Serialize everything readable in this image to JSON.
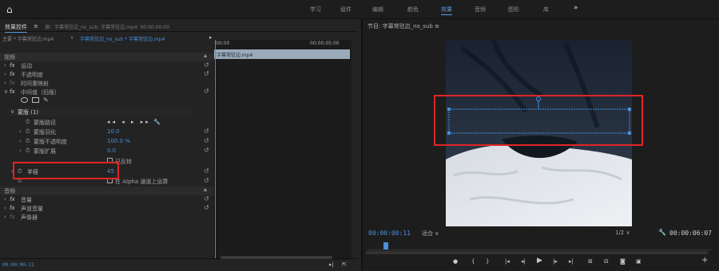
{
  "topbar": {
    "workspaces": [
      "学习",
      "组件",
      "编辑",
      "颜色",
      "效果",
      "音频",
      "图形",
      "库"
    ],
    "active": "效果",
    "more": "»"
  },
  "effect_controls": {
    "tab_label": "效果控件",
    "tab_menu": "≡",
    "other_tab": "源：字幕常驻边_no_sub: 字幕常驻边.mp4: 00:00:00:00",
    "source": "主要 * 字幕常驻边.mp4",
    "clip": "字幕常驻边_no_sub * 字幕常驻边.mp4",
    "tl_start": "00:00",
    "tl_end": "00:00:05:00",
    "clip_bar_label": "字幕常驻边.mp4",
    "section_video": "视频",
    "rows": [
      {
        "indent": 0,
        "fx": true,
        "label": "运动"
      },
      {
        "indent": 0,
        "fx": true,
        "label": "不透明度"
      },
      {
        "indent": 0,
        "fx": false,
        "label": "时间重映射"
      },
      {
        "indent": 0,
        "fx": true,
        "label": "中间值（旧版）"
      }
    ],
    "mask_label": "蒙版 (1)",
    "mask_rows": [
      {
        "label": "蒙版路径",
        "value": ""
      },
      {
        "label": "蒙版羽化",
        "value": "10.0"
      },
      {
        "label": "蒙版不透明度",
        "value": "100.0 %"
      },
      {
        "label": "蒙版扩展",
        "value": "0.0"
      }
    ],
    "inverted_label": "已反转",
    "radius_label": "半径",
    "radius_value": "45",
    "alpha_label": "在 Alpha 通道上运算",
    "section_audio": "音频",
    "audio_rows": [
      {
        "label": "音量"
      },
      {
        "label": "声道音量"
      },
      {
        "label": "声像器"
      }
    ],
    "footer_tc": "00:00:00:11"
  },
  "program_monitor": {
    "tab_label": "节目: 字幕常驻边_no_sub",
    "tab_menu": "≡",
    "current_tc": "00:00:00:11",
    "fit": "适合",
    "resolution": "1/2",
    "duration_tc": "00:00:06:07"
  }
}
